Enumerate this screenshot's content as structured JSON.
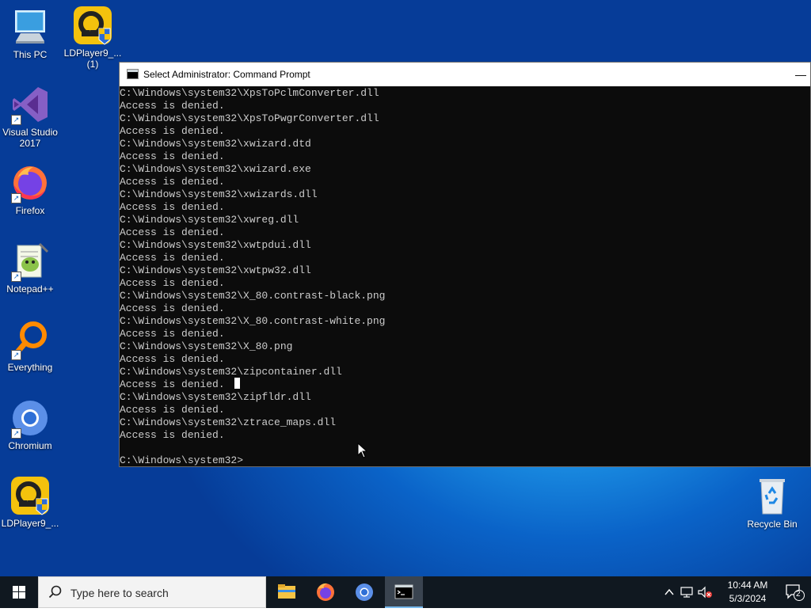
{
  "desktop": {
    "icons": [
      {
        "label": "This PC"
      },
      {
        "label": "LDPlayer9_...\n(1)"
      },
      {
        "label": "Visual Studio\n2017"
      },
      {
        "label": "Firefox"
      },
      {
        "label": "Notepad++"
      },
      {
        "label": "Everything"
      },
      {
        "label": "Chromium"
      },
      {
        "label": "LDPlayer9_..."
      },
      {
        "label": "Recycle Bin"
      }
    ]
  },
  "cmd": {
    "title": "Select Administrator: Command Prompt",
    "minimize_glyph": "—",
    "lines": [
      "C:\\Windows\\system32\\XpsToPclmConverter.dll",
      "Access is denied.",
      "C:\\Windows\\system32\\XpsToPwgrConverter.dll",
      "Access is denied.",
      "C:\\Windows\\system32\\xwizard.dtd",
      "Access is denied.",
      "C:\\Windows\\system32\\xwizard.exe",
      "Access is denied.",
      "C:\\Windows\\system32\\xwizards.dll",
      "Access is denied.",
      "C:\\Windows\\system32\\xwreg.dll",
      "Access is denied.",
      "C:\\Windows\\system32\\xwtpdui.dll",
      "Access is denied.",
      "C:\\Windows\\system32\\xwtpw32.dll",
      "Access is denied.",
      "C:\\Windows\\system32\\X_80.contrast-black.png",
      "Access is denied.",
      "C:\\Windows\\system32\\X_80.contrast-white.png",
      "Access is denied.",
      "C:\\Windows\\system32\\X_80.png",
      "Access is denied.",
      "C:\\Windows\\system32\\zipcontainer.dll",
      "Access is denied.",
      "C:\\Windows\\system32\\zipfldr.dll",
      "Access is denied.",
      "C:\\Windows\\system32\\ztrace_maps.dll",
      "Access is denied.",
      "",
      "C:\\Windows\\system32>"
    ]
  },
  "taskbar": {
    "search_placeholder": "Type here to search",
    "apps": [
      "file-explorer-icon",
      "firefox-icon",
      "chromium-icon",
      "command-prompt-icon"
    ],
    "time": "10:44 AM",
    "date": "5/3/2024",
    "notification_count": "2"
  },
  "colors": {
    "console_bg": "#0c0c0c",
    "console_text": "#cccccc",
    "taskbar_bg": "#101820",
    "active_indicator": "#76b9ed"
  }
}
